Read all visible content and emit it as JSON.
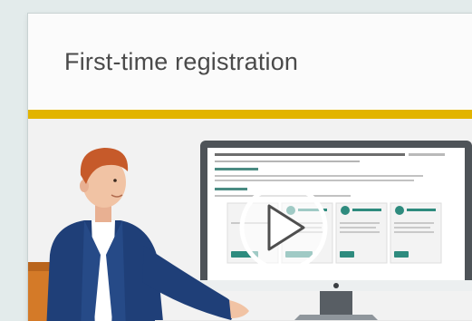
{
  "card": {
    "title": "First-time registration"
  },
  "video": {
    "play_icon": "play-icon"
  },
  "colors": {
    "accent": "#e2b400",
    "teal": "#2e8b7e",
    "jacket": "#1f3f78",
    "hair": "#c65a2a"
  }
}
